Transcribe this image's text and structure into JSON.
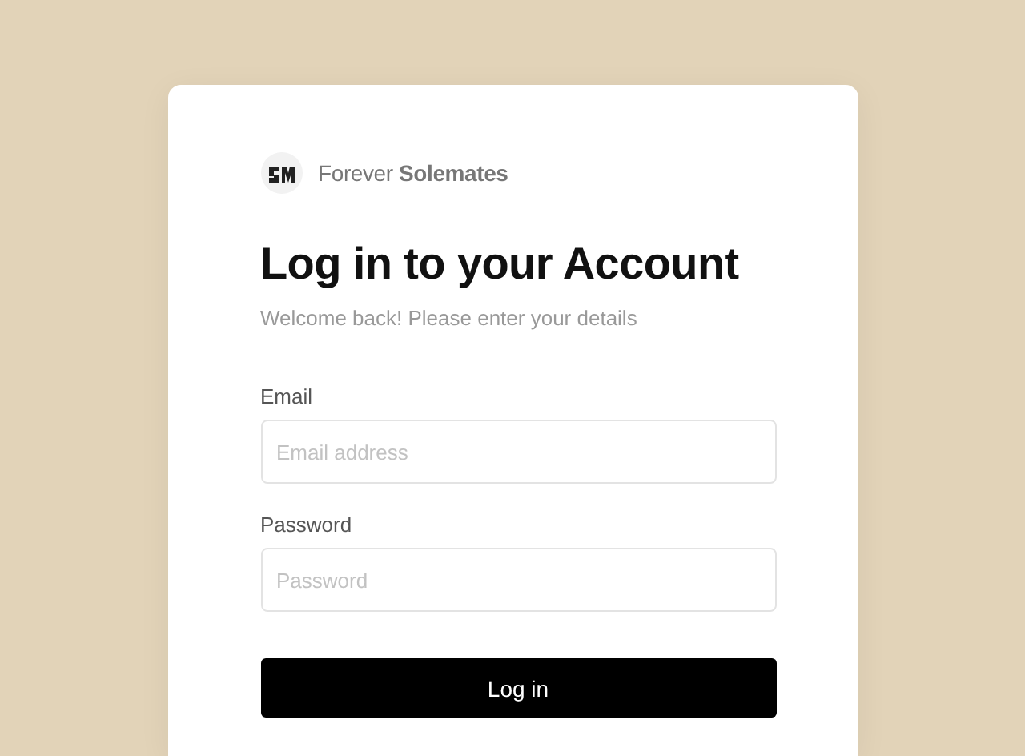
{
  "brand": {
    "name": "Forever **Solemates**"
  },
  "title": "Log in to your Account",
  "subtitle": "Welcome back! Please enter your details",
  "fields": [
    {
      "label": "Email",
      "placeholder": "Email address"
    },
    {
      "label": "Password",
      "placeholder": "Password"
    }
  ],
  "submit": {
    "label": "Log in"
  }
}
